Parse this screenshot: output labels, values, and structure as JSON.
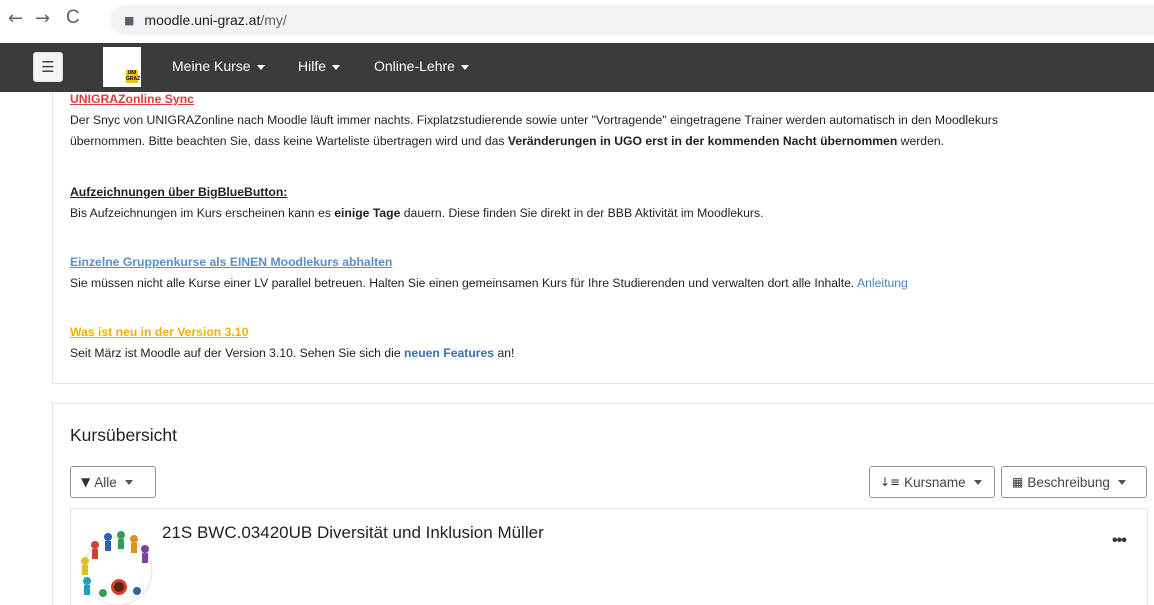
{
  "browser": {
    "back_icon": "←",
    "forward_icon": "→",
    "reload_icon": "C",
    "lock_icon": "🔒",
    "url_host": "moodle.uni-graz.at",
    "url_path": "/my/"
  },
  "navbar": {
    "hamburger_icon": "☰",
    "logo_text": "UNI GRAZ",
    "items": [
      {
        "label": "Meine Kurse"
      },
      {
        "label": "Hilfe"
      },
      {
        "label": "Online-Lehre"
      }
    ]
  },
  "notices": {
    "sync": {
      "heading": "UNIGRAZonline Sync",
      "line1": "Der Snyc von UNIGRAZonline nach Moodle läuft immer nachts. Fixplatzstudierende sowie unter \"Vortragende\" eingetragene Trainer werden automatisch in den Moodlekurs",
      "line2_a": "übernommen. Bitte beachten Sie, dass keine Warteliste übertragen wird und das ",
      "line2_b": "Veränderungen in UGO erst in der kommenden Nacht übernommen",
      "line2_c": " werden."
    },
    "bbb": {
      "heading": "Aufzeichnungen über BigBlueButton:",
      "line_a": "Bis Aufzeichnungen im Kurs erscheinen kann es ",
      "line_b": "einige Tage",
      "line_c": " dauern. Diese finden Sie direkt in der BBB Aktivität im Moodlekurs."
    },
    "groups": {
      "heading": "Einzelne Gruppenkurse als EINEN Moodlekurs abhalten",
      "line": "Sie müssen nicht alle Kurse einer LV parallel betreuen. Halten Sie einen gemeinsamen Kurs für Ihre Studierenden und verwalten dort alle Inhalte. ",
      "link": "Anleitung"
    },
    "version": {
      "heading": "Was ist neu in der Version 3.10",
      "line_a": "Seit März ist Moodle auf der Version 3.10. Sehen Sie sich die ",
      "line_b": "neuen Features",
      "line_c": " an!"
    }
  },
  "overview": {
    "title": "Kursübersicht",
    "filter_label": "Alle",
    "filter_icon": "▼",
    "sort_label": "Kursname",
    "sort_icon": "↓≡",
    "view_label": "Beschreibung",
    "view_icon": "▦",
    "courses": [
      {
        "name": "21S BWC.03420UB Diversität und Inklusion Müller",
        "more_icon": "•••"
      }
    ]
  },
  "colors": {
    "navbar": "#3b3b3b",
    "red_heading": "#e23a3a",
    "blue_heading": "#5a8fc6",
    "yellow_heading": "#f0b000",
    "logo_accent": "#f3c400"
  }
}
